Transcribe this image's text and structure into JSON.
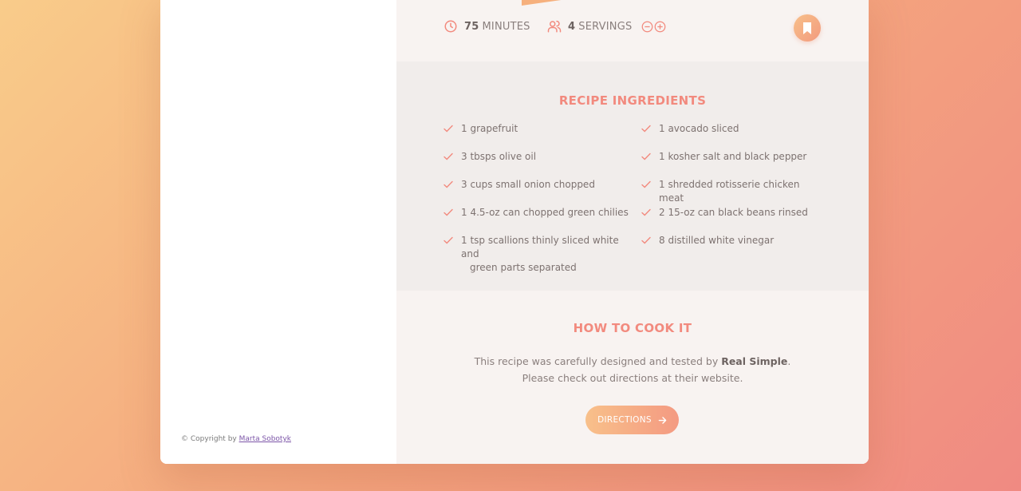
{
  "recipe": {
    "time_value": "75",
    "time_unit": "MINUTES",
    "servings_value": "4",
    "servings_unit": "SERVINGS"
  },
  "ingredients": {
    "title": "RECIPE INGREDIENTS",
    "left": [
      "1 grapefruit",
      "3 tbsps olive oil",
      "3 cups small onion chopped",
      "1 4.5-oz can chopped green chilies",
      "1 tsp scallions thinly sliced white and"
    ],
    "left_cont": "green parts separated",
    "right": [
      "1 avocado sliced",
      "1 kosher salt and black pepper",
      "1 shredded rotisserie chicken meat",
      "2 15-oz can black beans rinsed",
      "8 distilled white vinegar"
    ]
  },
  "cook": {
    "title": "HOW TO COOK IT",
    "text_before": "This recipe was carefully designed and tested by ",
    "source": "Real Simple",
    "text_after": ". Please check out directions at their website.",
    "button": "DIRECTIONS"
  },
  "footer": {
    "copyright": "© Copyright by ",
    "author": "Marta Sobotyk"
  },
  "colors": {
    "accent": "#f28a7e",
    "gradient_start": "#f8c08a",
    "gradient_end": "#f49a82",
    "panel_light": "#f8f3f1",
    "panel_mid": "#f1edeb"
  },
  "icons": [
    "clock-icon",
    "users-icon",
    "minus-circle-icon",
    "plus-circle-icon",
    "bookmark-icon",
    "check-icon",
    "arrow-right-icon"
  ]
}
